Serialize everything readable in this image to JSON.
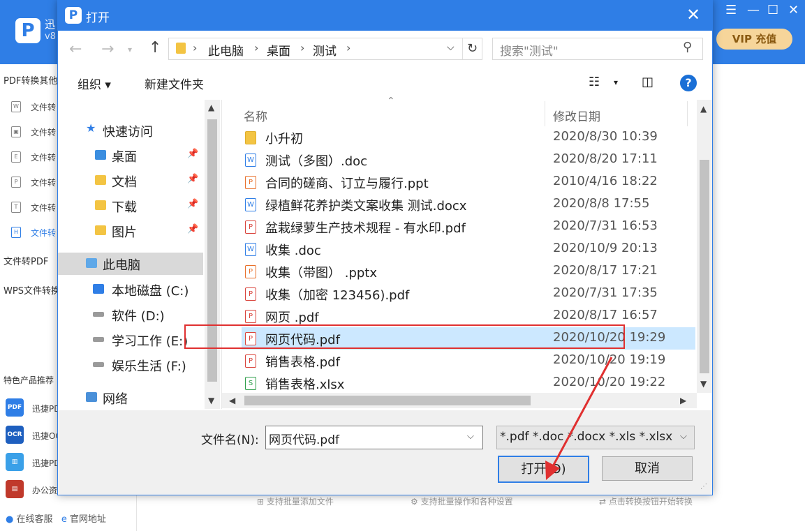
{
  "app": {
    "name_abbrev": "迅",
    "version_abbrev": "v8",
    "vip_label": "VIP 充值",
    "sidebar": {
      "section1": "PDF转换其他",
      "items": [
        "文件转",
        "文件转",
        "文件转",
        "文件转",
        "文件转",
        "文件转"
      ],
      "section2": "文件转PDF",
      "section3": "WPS文件转换",
      "section4": "特色产品推荐",
      "products": [
        "迅捷PDF",
        "迅捷OCR",
        "迅捷PDF",
        "办公资"
      ],
      "bottom_links": [
        "在线客服",
        "官网地址"
      ]
    },
    "hints": [
      "支持批量添加文件",
      "支持批量操作和各种设置",
      "点击转换按钮开始转换"
    ]
  },
  "dialog": {
    "title": "打开",
    "breadcrumb": [
      "此电脑",
      "桌面",
      "测试"
    ],
    "search_placeholder": "搜索\"测试\"",
    "toolbar": {
      "organize": "组织 ▾",
      "new_folder": "新建文件夹"
    },
    "nav": {
      "quick_access": "快速访问",
      "quick_items": [
        "桌面",
        "文档",
        "下载",
        "图片"
      ],
      "this_pc": "此电脑",
      "drives": [
        "本地磁盘 (C:)",
        "软件 (D:)",
        "学习工作 (E:)",
        "娱乐生活 (F:)"
      ],
      "network": "网络"
    },
    "columns": {
      "name": "名称",
      "modified": "修改日期"
    },
    "files": [
      {
        "name": "小升初",
        "date": "2020/8/30 10:39",
        "type": "folder"
      },
      {
        "name": "测试（多图）.doc",
        "date": "2020/8/20 17:11",
        "type": "doc"
      },
      {
        "name": "合同的磋商、订立与履行.ppt",
        "date": "2010/4/16 18:22",
        "type": "ppt"
      },
      {
        "name": "绿植鲜花养护类文案收集  测试.docx",
        "date": "2020/8/8 17:55",
        "type": "doc"
      },
      {
        "name": "盆栽绿萝生产技术规程 - 有水印.pdf",
        "date": "2020/7/31 16:53",
        "type": "pdf"
      },
      {
        "name": "收集 .doc",
        "date": "2020/10/9 20:13",
        "type": "doc"
      },
      {
        "name": "收集（带图） .pptx",
        "date": "2020/8/17 17:21",
        "type": "ppt"
      },
      {
        "name": "收集（加密 123456).pdf",
        "date": "2020/7/31 17:35",
        "type": "pdf"
      },
      {
        "name": "网页 .pdf",
        "date": "2020/8/17 16:57",
        "type": "pdf"
      },
      {
        "name": "网页代码.pdf",
        "date": "2020/10/20 19:29",
        "type": "pdf",
        "selected": true
      },
      {
        "name": "销售表格.pdf",
        "date": "2020/10/20 19:19",
        "type": "pdf"
      },
      {
        "name": "销售表格.xlsx",
        "date": "2020/10/20 19:22",
        "type": "xls"
      }
    ],
    "filename_label": "文件名(N):",
    "filename_value": "网页代码.pdf",
    "filter_value": "*.pdf *.doc *.docx *.xls *.xlsx *",
    "open_label": "打开(O)",
    "cancel_label": "取消"
  },
  "colors": {
    "accent": "#2f7ee6",
    "selection": "#cce8ff",
    "highlight_box": "#e03030"
  }
}
